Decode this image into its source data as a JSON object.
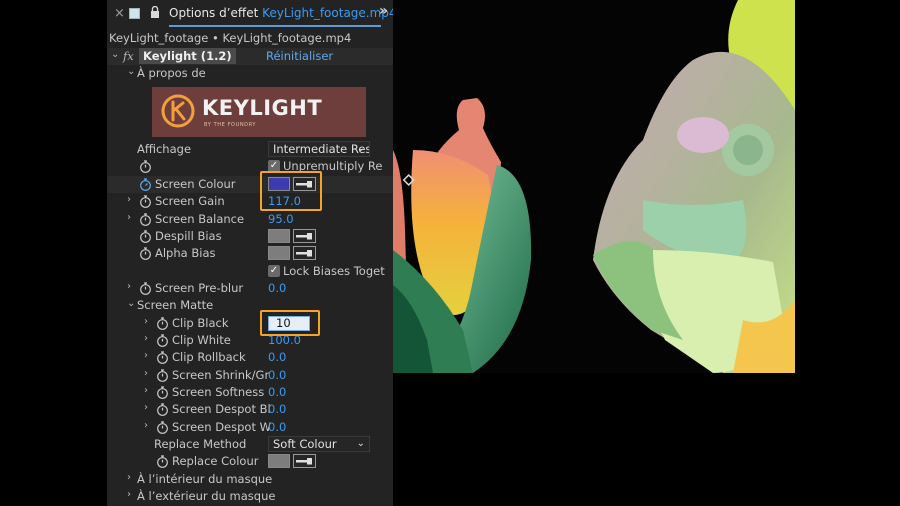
{
  "panel": {
    "tab_title_prefix": "Options d’effet",
    "tab_title_file": "KeyLight_footage.mp4",
    "layer_path": "KeyLight_footage • KeyLight_footage.mp4",
    "more_icon": "double-chevron-right-icon"
  },
  "effect": {
    "fx_symbol": "fx",
    "name": "Keylight (1.2)",
    "reset_label": "Réinitialiser",
    "about_label": "À propos de",
    "logo_text": "KEYLIGHT",
    "logo_subtext": "BY THE FOUNDRY"
  },
  "rows": {
    "affichage": {
      "label": "Affichage",
      "value": "Intermediate Res"
    },
    "unpremultiply": {
      "label": "Unpremultiply Re",
      "checked": true
    },
    "screen_colour": {
      "label": "Screen Colour",
      "color": "#3c3cae"
    },
    "screen_gain": {
      "label": "Screen Gain",
      "value": "117.0"
    },
    "screen_balance": {
      "label": "Screen Balance",
      "value": "95.0"
    },
    "despill_bias": {
      "label": "Despill Bias"
    },
    "alpha_bias": {
      "label": "Alpha Bias"
    },
    "lock_biases": {
      "label": "Lock Biases Toget",
      "checked": true
    },
    "screen_preblur": {
      "label": "Screen Pre-blur",
      "value": "0.0"
    },
    "screen_matte": {
      "label": "Screen Matte"
    },
    "clip_black": {
      "label": "Clip Black",
      "value": "10"
    },
    "clip_white": {
      "label": "Clip White",
      "value": "100.0"
    },
    "clip_rollback": {
      "label": "Clip Rollback",
      "value": "0.0"
    },
    "screen_shrink": {
      "label": "Screen Shrink/Gr",
      "value": "0.0"
    },
    "screen_softness": {
      "label": "Screen Softness",
      "value": "0.0"
    },
    "screen_despot_bl": {
      "label": "Screen Despot Bl",
      "value": "0.0"
    },
    "screen_despot_w": {
      "label": "Screen Despot W",
      "value": "0.0"
    },
    "replace_method": {
      "label": "Replace Method",
      "value": "Soft Colour"
    },
    "replace_colour": {
      "label": "Replace Colour"
    },
    "inside_mask": {
      "label": "À l’intérieur du masque"
    },
    "outside_mask": {
      "label": "À l’extérieur du masque"
    }
  },
  "colors": {
    "accent_blue": "#3a9bf2",
    "highlight_orange": "#f4a526",
    "panel_bg": "#232323"
  }
}
